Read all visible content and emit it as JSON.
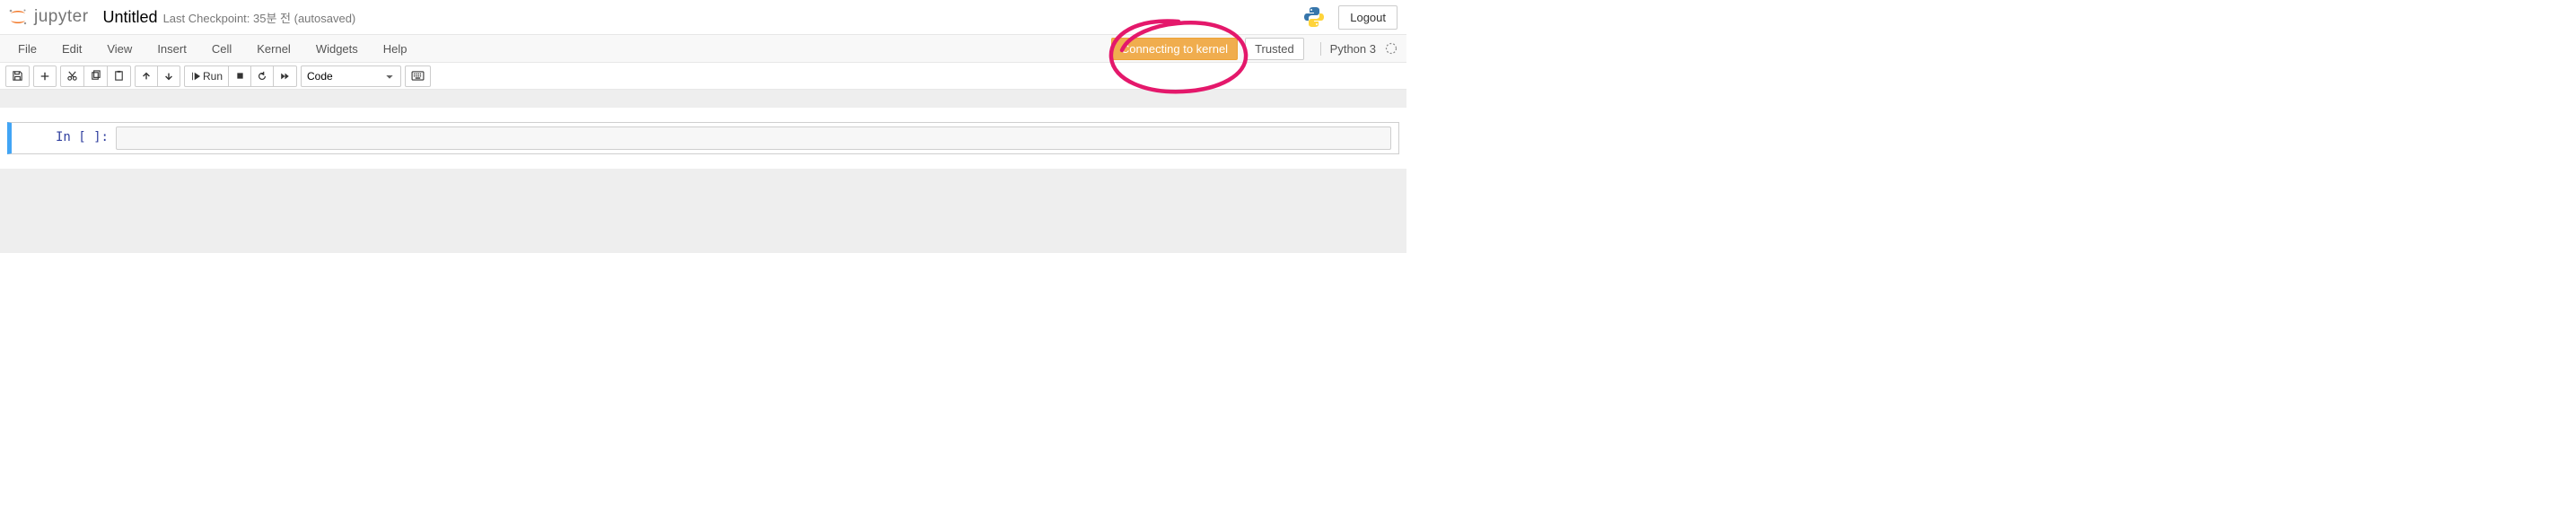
{
  "header": {
    "logo_text": "jupyter",
    "notebook_name": "Untitled",
    "checkpoint": "Last Checkpoint: 35분 전  (autosaved)",
    "logout_label": "Logout"
  },
  "menubar": {
    "items": [
      {
        "label": "File"
      },
      {
        "label": "Edit"
      },
      {
        "label": "View"
      },
      {
        "label": "Insert"
      },
      {
        "label": "Cell"
      },
      {
        "label": "Kernel"
      },
      {
        "label": "Widgets"
      },
      {
        "label": "Help"
      }
    ],
    "kernel_status": "Connecting to kernel",
    "trusted": "Trusted",
    "kernel_name": "Python 3"
  },
  "toolbar": {
    "run_label": "Run",
    "cell_type_selected": "Code"
  },
  "cell": {
    "prompt": "In [ ]:"
  },
  "colors": {
    "warning": "#f0ad4e",
    "selected_cell_border": "#42A5F5",
    "annotation": "#E91E63"
  }
}
